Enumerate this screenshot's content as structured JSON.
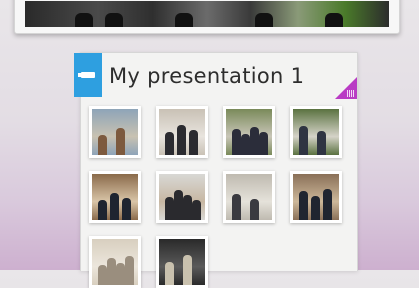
{
  "presentation": {
    "title": "My presentation 1",
    "tab_icon": "presentation-icon",
    "corner_icon": "grid-icon",
    "accent_tab": "#2e9fe0",
    "accent_corner": "#b93bc4"
  },
  "thumbnails": [
    {
      "name": "photo-1",
      "palette": [
        "#8ea4b8",
        "#7d5a3e",
        "#c8c2b2"
      ]
    },
    {
      "name": "photo-2",
      "palette": [
        "#c9c1b5",
        "#2b2b30",
        "#e8e4de"
      ]
    },
    {
      "name": "photo-3",
      "palette": [
        "#7a8a5a",
        "#2b2d3a",
        "#c9c6b8"
      ]
    },
    {
      "name": "photo-4",
      "palette": [
        "#5a7240",
        "#2f3442",
        "#d5d3c8"
      ]
    },
    {
      "name": "photo-5",
      "palette": [
        "#8a6a4a",
        "#1e2430",
        "#d9c5a8"
      ]
    },
    {
      "name": "photo-6",
      "palette": [
        "#d8d8d5",
        "#2a2a2e",
        "#c7b7a2"
      ]
    },
    {
      "name": "photo-7",
      "palette": [
        "#bfbab0",
        "#3a3a40",
        "#e5e2da"
      ]
    },
    {
      "name": "photo-8",
      "palette": [
        "#8a7058",
        "#202530",
        "#cdb89a"
      ]
    },
    {
      "name": "photo-9",
      "palette": [
        "#d8cfbf",
        "#9a8e7e",
        "#ece6dc"
      ]
    },
    {
      "name": "photo-10",
      "palette": [
        "#2a2a2a",
        "#c9c1ae",
        "#5a5a5a"
      ]
    }
  ]
}
